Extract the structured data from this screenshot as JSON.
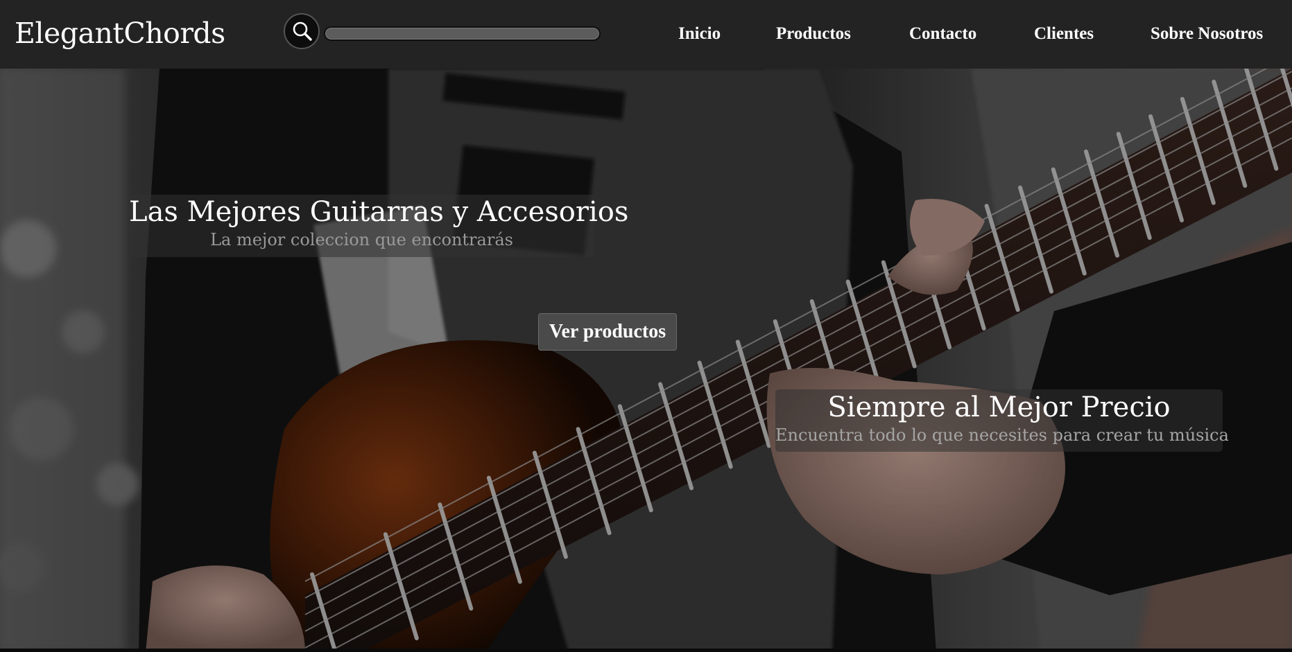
{
  "brand": {
    "name": "ElegantChords"
  },
  "search": {
    "value": "",
    "placeholder": "",
    "icon": "search-icon"
  },
  "nav": {
    "items": [
      {
        "label": "Inicio"
      },
      {
        "label": "Productos"
      },
      {
        "label": "Contacto"
      },
      {
        "label": "Clientes"
      },
      {
        "label": "Sobre Nosotros"
      }
    ]
  },
  "hero": {
    "background": "guitar-photo",
    "captions": [
      {
        "title": "Las Mejores Guitarras y Accesorios",
        "subtitle": "La mejor coleccion que encontrarás"
      },
      {
        "title": "Siempre al Mejor Precio",
        "subtitle": "Encuentra todo lo que necesites para crear tu música"
      }
    ],
    "cta_label": "Ver productos"
  },
  "colors": {
    "navbar_bg": "#232323",
    "text": "#ffffff",
    "caption_bg": "rgba(50,50,50,0.55)",
    "subtitle": "#9a9a9a",
    "button_bg": "#4a4a4a"
  }
}
